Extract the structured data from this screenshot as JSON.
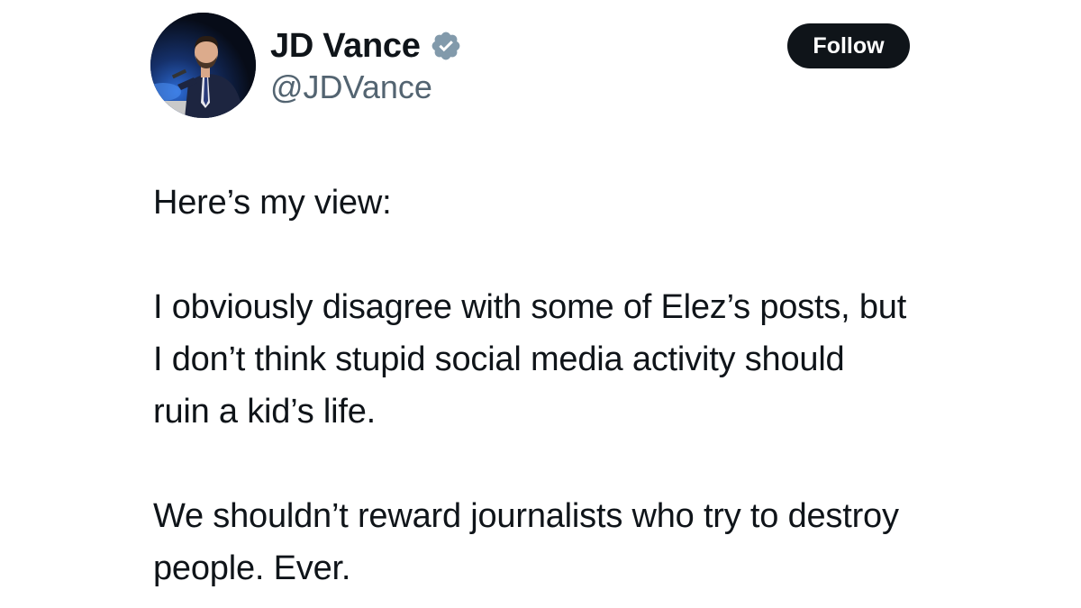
{
  "author": {
    "display_name": "JD Vance",
    "handle": "@JDVance",
    "verified": true,
    "verified_color": "#829aab"
  },
  "follow_button": {
    "label": "Follow"
  },
  "tweet": {
    "paragraphs": [
      "Here’s my view:",
      "I obviously disagree with some of Elez’s posts, but I don’t think stupid social media activity should ruin a kid’s life.",
      "We shouldn’t reward journalists who try to destroy people. Ever."
    ]
  },
  "colors": {
    "text": "#0f1419",
    "secondary_text": "#536471",
    "button_bg": "#0f1419",
    "button_text": "#ffffff"
  },
  "icons": {
    "avatar": "profile-photo",
    "verified": "verified-badge-icon"
  }
}
